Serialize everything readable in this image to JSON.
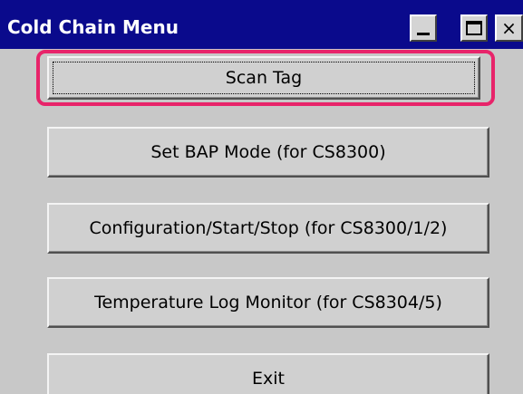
{
  "window": {
    "title": "Cold Chain Menu"
  },
  "titlebar_buttons": {
    "minimize_icon": "minimize-icon",
    "maximize_icon": "maximize-icon",
    "close_label": "×"
  },
  "menu": {
    "items": [
      {
        "label": "Scan Tag",
        "focused": true,
        "highlighted": true
      },
      {
        "label": "Set BAP Mode (for CS8300)"
      },
      {
        "label": "Configuration/Start/Stop (for CS8300/1/2)"
      },
      {
        "label": "Temperature Log Monitor (for CS8304/5)"
      },
      {
        "label": "Exit"
      }
    ]
  },
  "colors": {
    "titlebar": "#0a0a8c",
    "background": "#c8c8c8",
    "highlight": "#e8246a"
  }
}
